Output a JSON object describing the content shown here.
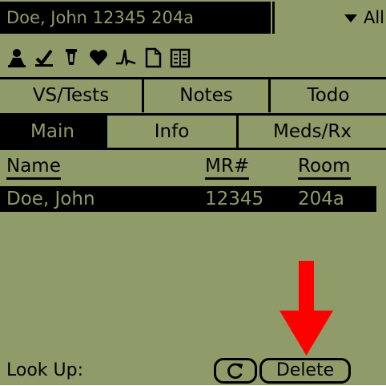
{
  "titlebar": {
    "patient": "Doe, John 12345 204a",
    "filter": "All"
  },
  "toolbar_icons": [
    "person-icon",
    "procedure-icon",
    "tube-icon",
    "heart-icon",
    "waveform-icon",
    "page-icon",
    "book-icon"
  ],
  "tabs_row1": [
    "VS/Tests",
    "Notes",
    "Todo"
  ],
  "tabs_row2": [
    "Main",
    "Info",
    "Meds/Rx"
  ],
  "table": {
    "headers": [
      "Name",
      "MR#",
      "Room"
    ],
    "rows": [
      {
        "name": "Doe, John",
        "mr": "12345",
        "room": "204a"
      }
    ]
  },
  "bottom": {
    "lookup_label": "Look Up:",
    "delete_label": "Delete"
  },
  "colors": {
    "screen_bg": "#8f9c6a",
    "ink": "#000000",
    "annotation_arrow": "#ff0000"
  }
}
